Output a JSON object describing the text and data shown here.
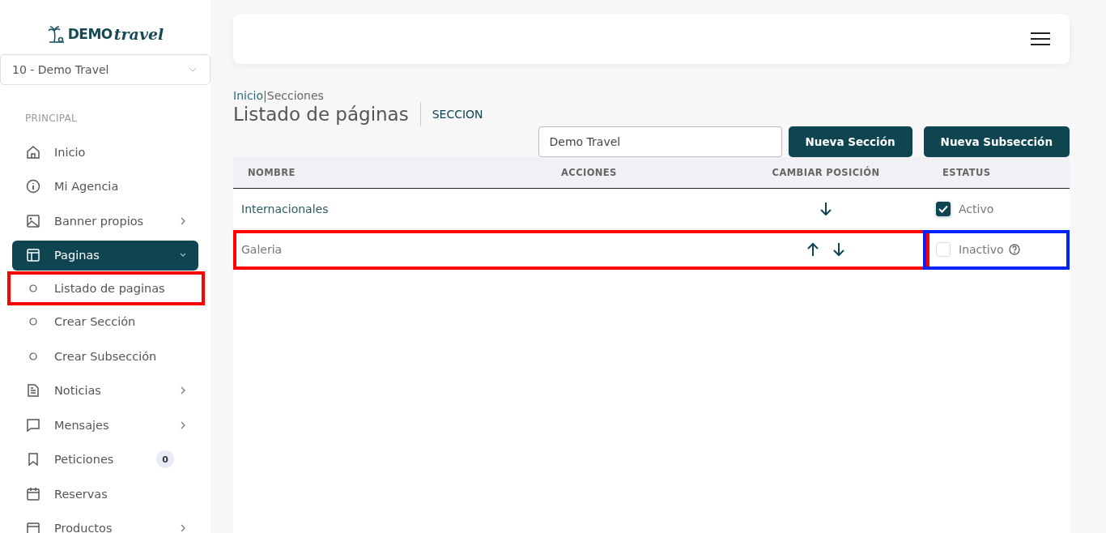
{
  "logo": {
    "brand": "DEMO",
    "script": "travel"
  },
  "agency_select": {
    "value": "10 - Demo Travel"
  },
  "sidebar": {
    "section": "PRINCIPAL",
    "items": [
      {
        "label": "Inicio",
        "kind": "item",
        "selected": false
      },
      {
        "label": "Mi Agencia",
        "kind": "item",
        "selected": false
      },
      {
        "label": "Banner propios",
        "kind": "item",
        "selected": false,
        "expanded": false
      },
      {
        "label": "Paginas",
        "kind": "item",
        "selected": true,
        "expanded": true
      },
      {
        "label": "Listado de paginas",
        "kind": "subitem",
        "selected": false,
        "outlined": true
      },
      {
        "label": "Crear Sección",
        "kind": "subitem",
        "selected": false,
        "outlined": false
      },
      {
        "label": "Crear Subsección",
        "kind": "subitem",
        "selected": false,
        "outlined": false
      },
      {
        "label": "Noticias",
        "kind": "item",
        "selected": false,
        "expanded": false
      },
      {
        "label": "Mensajes",
        "kind": "item",
        "selected": false,
        "expanded": false
      },
      {
        "label": "Peticiones",
        "kind": "item",
        "selected": false,
        "badge": "0"
      },
      {
        "label": "Reservas",
        "kind": "item",
        "selected": false
      },
      {
        "label": "Productos",
        "kind": "item",
        "selected": false,
        "expanded": false
      }
    ]
  },
  "breadcrumb": {
    "link": "Inicio",
    "separator": "|",
    "current": "Secciones"
  },
  "page_title": "Listado de páginas",
  "page_subtitle": "SECCION",
  "filter_select": {
    "value": "Demo Travel"
  },
  "buttons": [
    "Nueva Sección",
    "Nueva Subsección"
  ],
  "table": {
    "columns": [
      "NOMBRE",
      "ACCIONES",
      "CAMBIAR POSICIÓN",
      "ESTATUS"
    ],
    "rows": [
      {
        "name": "Internacionales",
        "can_move_up": false,
        "can_move_down": true,
        "checked": true,
        "status": "Activo",
        "help": false,
        "outlined": false,
        "status_outlined": false
      },
      {
        "name": "Galeria",
        "can_move_up": true,
        "can_move_down": true,
        "checked": false,
        "status": "Inactivo",
        "help": true,
        "outlined": true,
        "status_outlined": true
      }
    ]
  }
}
